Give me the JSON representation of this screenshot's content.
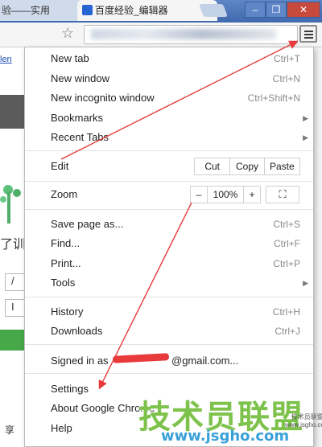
{
  "tabs": [
    {
      "title": "验——实用",
      "active": false
    },
    {
      "title": "百度经验_编辑器",
      "active": true
    }
  ],
  "window": {
    "minimize": "–",
    "restore": "❐",
    "close": "✕"
  },
  "toolbar": {
    "bookmark_icon": "star-icon",
    "menu_icon": "hamburger-menu-icon"
  },
  "page": {
    "link_text": "len",
    "cjk_text": "了训",
    "box_1": "/",
    "box_2": "I",
    "bottom_text": "享"
  },
  "menu": {
    "new_tab": {
      "label": "New tab",
      "shortcut": "Ctrl+T"
    },
    "new_window": {
      "label": "New window",
      "shortcut": "Ctrl+N"
    },
    "new_incognito": {
      "label": "New incognito window",
      "shortcut": "Ctrl+Shift+N"
    },
    "bookmarks": {
      "label": "Bookmarks"
    },
    "recent_tabs": {
      "label": "Recent Tabs"
    },
    "edit": {
      "label": "Edit",
      "cut": "Cut",
      "copy": "Copy",
      "paste": "Paste"
    },
    "zoom": {
      "label": "Zoom",
      "minus": "–",
      "level": "100%",
      "plus": "+",
      "fullscreen": "⛶"
    },
    "save_page": {
      "label": "Save page as...",
      "shortcut": "Ctrl+S"
    },
    "find": {
      "label": "Find...",
      "shortcut": "Ctrl+F"
    },
    "print": {
      "label": "Print...",
      "shortcut": "Ctrl+P"
    },
    "tools": {
      "label": "Tools"
    },
    "history": {
      "label": "History",
      "shortcut": "Ctrl+H"
    },
    "downloads": {
      "label": "Downloads",
      "shortcut": "Ctrl+J"
    },
    "signed_in": {
      "label_prefix": "Signed in as",
      "label_suffix": "@gmail.com..."
    },
    "settings": {
      "label": "Settings"
    },
    "about": {
      "label": "About Google Chrome"
    },
    "help": {
      "label": "Help"
    }
  },
  "watermark": {
    "brand": "技术员联盟",
    "url": "www.jsgho.com",
    "logo_line1": "技术员联盟",
    "logo_line2": "www.jsgho.com"
  },
  "colors": {
    "annotation_red": "#e83a3a",
    "watermark_green": "#7dc24a",
    "watermark_blue": "#3aa0d8",
    "chrome_blue": "#4f79bd"
  }
}
